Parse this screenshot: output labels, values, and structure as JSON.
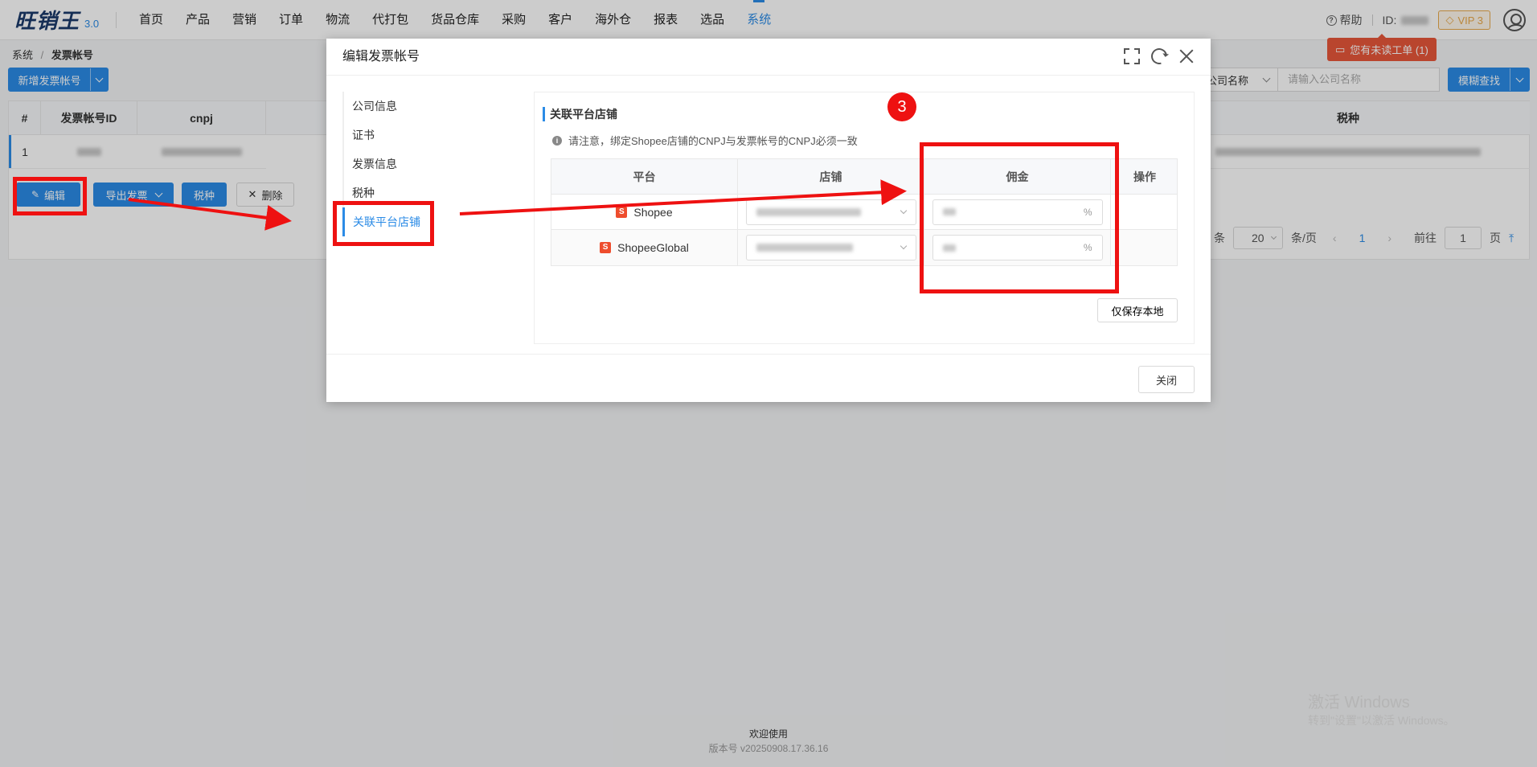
{
  "app": {
    "logo_text": "旺销王",
    "logo_version": "3.0"
  },
  "nav": {
    "items": [
      "首页",
      "产品",
      "营销",
      "订单",
      "物流",
      "代打包",
      "货品仓库",
      "采购",
      "客户",
      "海外仓",
      "报表",
      "选品",
      "系统"
    ],
    "active_index": 12,
    "help": "帮助",
    "id_label": "ID:",
    "vip": "VIP 3",
    "ticket": "您有未读工单 (1)"
  },
  "breadcrumb": {
    "root": "系统",
    "sep": "/",
    "current": "发票帐号"
  },
  "toolbar": {
    "add_label": "新增发票帐号",
    "filter_select": "公司名称",
    "search_placeholder": "请输入公司名称",
    "fuzzy_label": "模糊查找"
  },
  "table": {
    "columns": {
      "index": "#",
      "id": "发票帐号ID",
      "cnpj": "cnpj",
      "tax": "税种"
    },
    "row": {
      "index": "1"
    }
  },
  "row_actions": {
    "edit": "编辑",
    "export": "导出发票",
    "tax": "税种",
    "delete": "删除"
  },
  "pager": {
    "unit_tail": "条",
    "page_size": "20",
    "per_page": "条/页",
    "current": "1",
    "goto": "前往",
    "goto_value": "1",
    "page_unit": "页"
  },
  "modal": {
    "title": "编辑发票帐号",
    "tabs": [
      "公司信息",
      "证书",
      "发票信息",
      "税种",
      "关联平台店铺"
    ],
    "active_tab": 4,
    "section_title": "关联平台店铺",
    "notice": "请注意，绑定Shopee店铺的CNPJ与发票帐号的CNPJ必须一致",
    "columns": {
      "platform": "平台",
      "shop": "店铺",
      "commission": "佣金",
      "ops": "操作"
    },
    "rows": [
      {
        "platform": "Shopee",
        "unit": "%"
      },
      {
        "platform": "ShopeeGlobal",
        "unit": "%"
      }
    ],
    "save_local": "仅保存本地",
    "close": "关闭"
  },
  "annotation": {
    "step": "3",
    "color": "#ee1111"
  },
  "footer": {
    "welcome": "欢迎使用",
    "version": "版本号 v20250908.17.36.16"
  },
  "watermark": {
    "line1": "激活 Windows",
    "line2": "转到\"设置\"以激活 Windows。"
  },
  "colors": {
    "primary": "#2b8be6",
    "shopee": "#ee4d2d",
    "ticket": "#e8573a",
    "vip": "#e9a94b"
  }
}
